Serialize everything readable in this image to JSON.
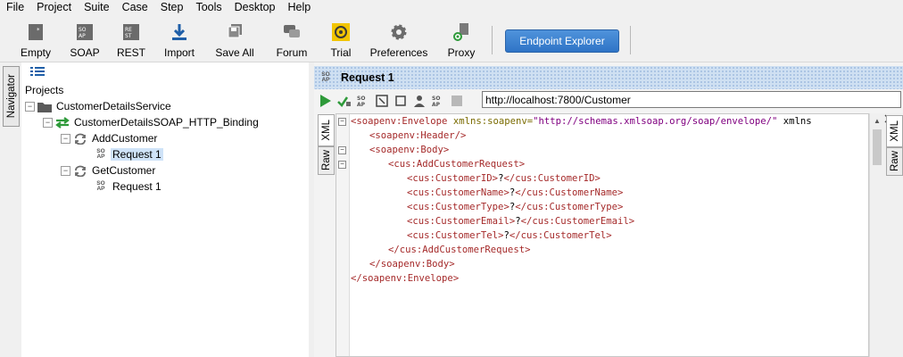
{
  "menu": [
    "File",
    "Project",
    "Suite",
    "Case",
    "Step",
    "Tools",
    "Desktop",
    "Help"
  ],
  "toolbar": {
    "empty": "Empty",
    "soap": "SOAP",
    "rest": "REST",
    "import": "Import",
    "save_all": "Save All",
    "forum": "Forum",
    "trial": "Trial",
    "preferences": "Preferences",
    "proxy": "Proxy",
    "endpoint_explorer": "Endpoint Explorer"
  },
  "navigator": {
    "tab_label": "Navigator"
  },
  "tree": {
    "root": "Projects",
    "project": "CustomerDetailsService",
    "binding": "CustomerDetailsSOAP_HTTP_Binding",
    "operations": [
      {
        "name": "AddCustomer",
        "request": "Request 1",
        "selected": true
      },
      {
        "name": "GetCustomer",
        "request": "Request 1",
        "selected": false
      }
    ]
  },
  "request": {
    "title": "Request 1",
    "url": "http://localhost:7800/Customer",
    "tabs": {
      "xml": "XML",
      "raw": "Raw"
    },
    "response_tabs": {
      "xml": "XML",
      "raw": "Raw"
    }
  },
  "xml_lines": [
    "<soapenv:Envelope xmlns:soapenv=\"http://schemas.xmlsoap.org/soap/envelope/\" xmlns",
    "<soapenv:Header/>",
    "<soapenv:Body>",
    "<cus:AddCustomerRequest>",
    "<cus:CustomerID>?</cus:CustomerID>",
    "<cus:CustomerName>?</cus:CustomerName>",
    "<cus:CustomerType>?</cus:CustomerType>",
    "<cus:CustomerEmail>?</cus:CustomerEmail>",
    "<cus:CustomerTel>?</cus:CustomerTel>",
    "</cus:AddCustomerRequest>",
    "</soapenv:Body>",
    "</soapenv:Envelope>"
  ],
  "colors": {
    "endpoint_button": "#3b82d0",
    "selected_row": "#cfe3f8",
    "xml_tag": "#a52a2a",
    "xml_string": "#800080"
  }
}
